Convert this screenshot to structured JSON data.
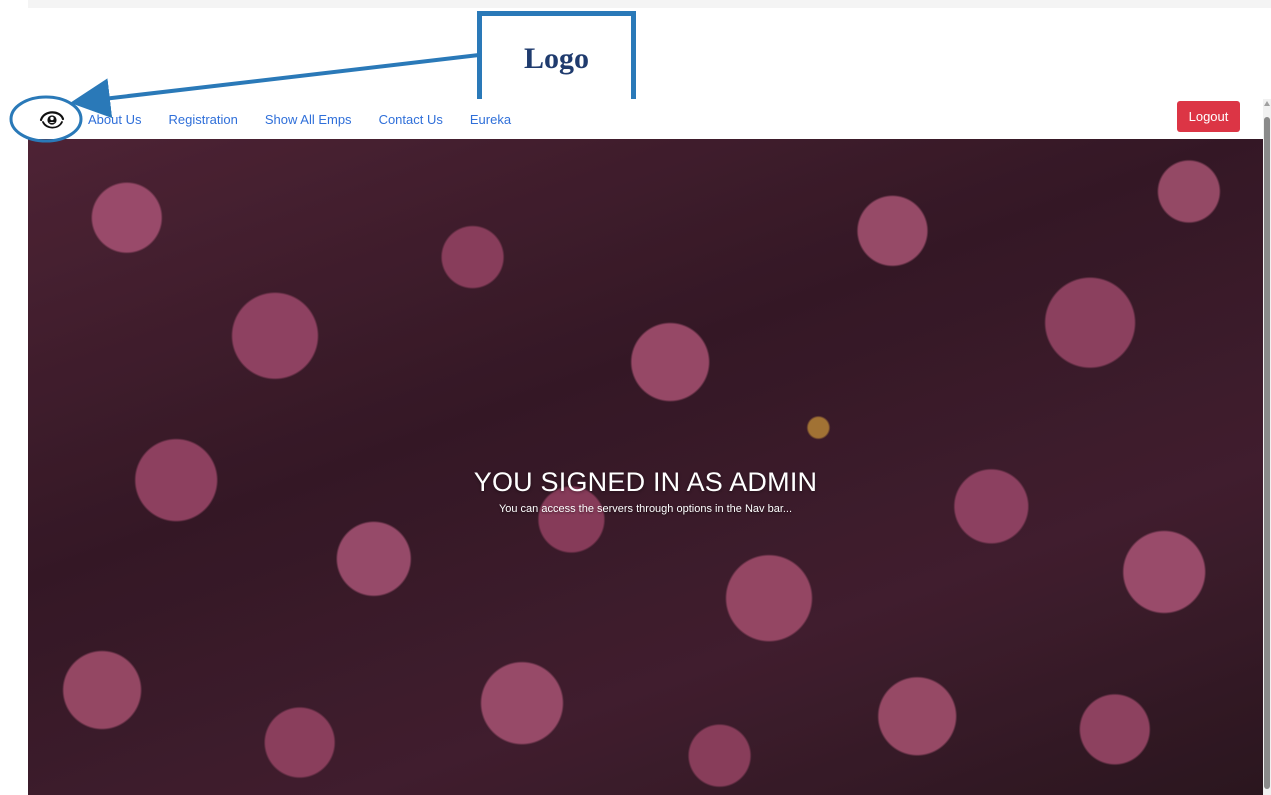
{
  "annotation": {
    "callout_label": "Logo",
    "accent_color": "#2a79b8"
  },
  "navbar": {
    "logo_icon": "eye-logo-icon",
    "links": [
      "About Us",
      "Registration",
      "Show All Emps",
      "Contact Us",
      "Eureka"
    ],
    "logout_label": "Logout",
    "link_color": "#2f6fd9",
    "logout_color": "#dc3545"
  },
  "hero": {
    "title": "YOU SIGNED IN AS ADMIN",
    "subtitle": "You can access the servers through options in the Nav bar..."
  }
}
